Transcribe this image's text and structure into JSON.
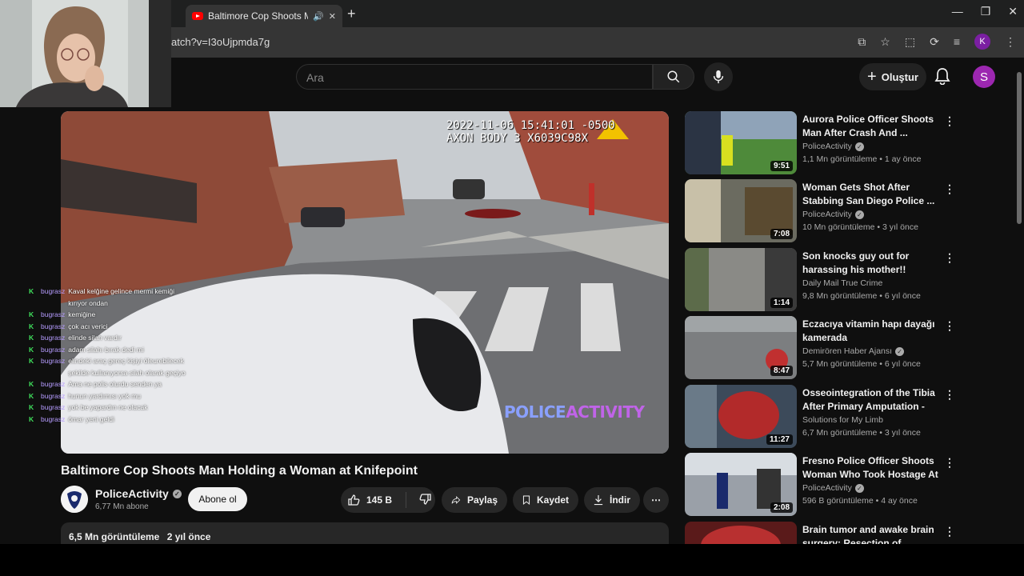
{
  "browser": {
    "tab_title": "Baltimore Cop Shoots Man",
    "url": "atch?v=I3oUjpmda7g",
    "profile_initial": "K"
  },
  "header": {
    "search_placeholder": "Ara",
    "create_label": "Oluştur",
    "avatar_initial": "S"
  },
  "video": {
    "timestamp": "2022-11-06 15:41:01 -0500",
    "camera_id": "AXON BODY 3 X6039C98X",
    "watermark_part1": "POLICE",
    "watermark_part2": "ACTIVITY",
    "title": "Baltimore Cop Shoots Man Holding a Woman at Knifepoint"
  },
  "channel": {
    "name": "PoliceActivity",
    "subscribers": "6,77 Mn abone",
    "subscribe_label": "Abone ol"
  },
  "actions": {
    "likes": "145 B",
    "share": "Paylaş",
    "save": "Kaydet",
    "download": "İndir"
  },
  "description": {
    "views": "6,5 Mn görüntüleme",
    "age": "2 yıl önce"
  },
  "chat": [
    {
      "user": "bugrasz",
      "text": "Kaval kelğine gelince mermi kemiği kırıyor ondan"
    },
    {
      "user": "bugrasz",
      "text": "kemiğine"
    },
    {
      "user": "bugrasz",
      "text": "çok acı verici"
    },
    {
      "user": "bugrasz",
      "text": "elinde silah vardır"
    },
    {
      "user": "bugrasz",
      "text": "adam silahı bırak dedi mi"
    },
    {
      "user": "bugrasz",
      "text": "elindeki araç gereç kişiyi öleurebilecek şekilde kullanıyorsa silah olarak geçiyo"
    },
    {
      "user": "bugrasz",
      "text": "Ama ne polis olurdu senden ya"
    },
    {
      "user": "bugrasz",
      "text": "hunun yardımı​sı yok mu"
    },
    {
      "user": "bugrasz",
      "text": "yok be yapardın ne olacak"
    },
    {
      "user": "bugrasz",
      "text": "ömar yeni geldi"
    }
  ],
  "recommendations": [
    {
      "title": "Aurora Police Officer Shoots Man After Crash And ...",
      "channel": "PoliceActivity",
      "verified": true,
      "views": "1,1 Mn görüntüleme",
      "age": "1 ay önce",
      "duration": "9:51"
    },
    {
      "title": "Woman Gets Shot After Stabbing San Diego Police ...",
      "channel": "PoliceActivity",
      "verified": true,
      "views": "10 Mn görüntüleme",
      "age": "3 yıl önce",
      "duration": "7:08"
    },
    {
      "title": "Son knocks guy out for harassing his mother!!",
      "channel": "Daily Mail True Crime",
      "verified": false,
      "views": "9,8 Mn görüntüleme",
      "age": "6 yıl önce",
      "duration": "1:14"
    },
    {
      "title": "Eczacıya vitamin hapı dayağı kamerada",
      "channel": "Demirören Haber Ajansı",
      "verified": true,
      "views": "5,7 Mn görüntüleme",
      "age": "6 yıl önce",
      "duration": "8:47"
    },
    {
      "title": "Osseointegration of the Tibia After Primary Amputation - Liv...",
      "channel": "Solutions for My Limb",
      "verified": false,
      "views": "6,7 Mn görüntüleme",
      "age": "3 yıl önce",
      "duration": "11:27"
    },
    {
      "title": "Fresno Police Officer Shoots Woman Who Took Hostage At ...",
      "channel": "PoliceActivity",
      "verified": true,
      "views": "596 B görüntüleme",
      "age": "4 ay önce",
      "duration": "2:08"
    },
    {
      "title": "Brain tumor and awake brain surgery: Resection of ...",
      "channel": "",
      "verified": false,
      "views": "",
      "age": "",
      "duration": ""
    }
  ]
}
